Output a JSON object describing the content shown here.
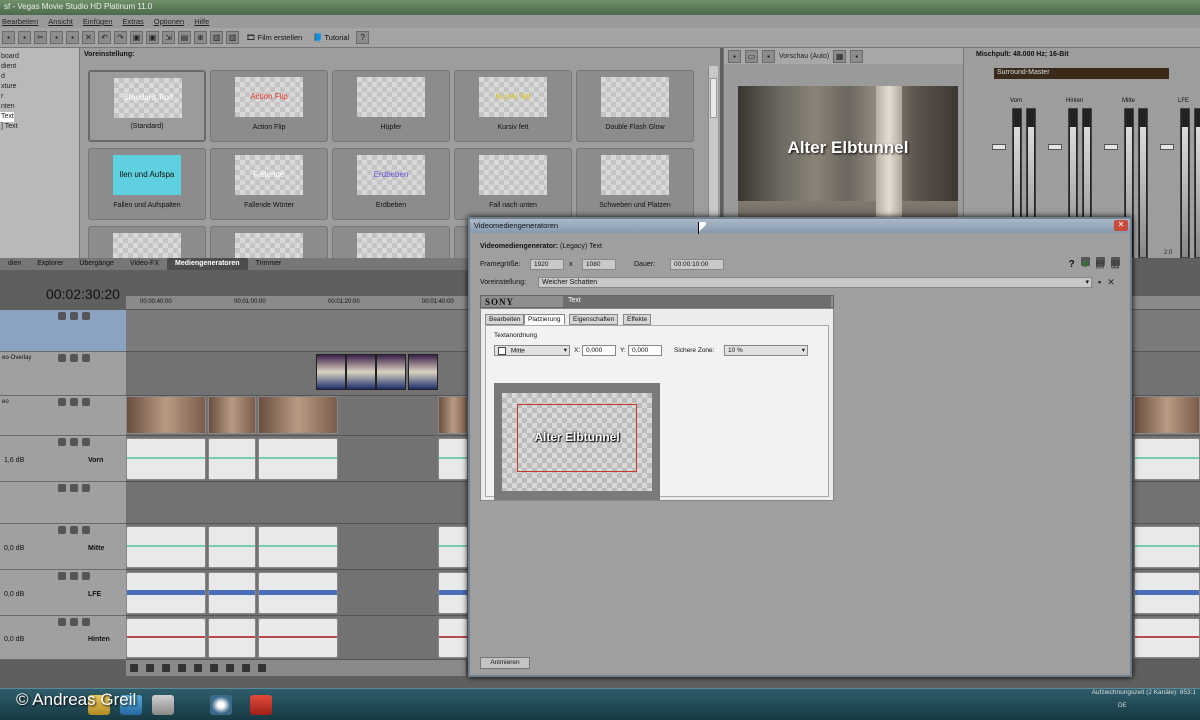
{
  "window": {
    "title": "sf - Vegas Movie Studio HD Platinum 11.0"
  },
  "menu": [
    "Bearbeiten",
    "Ansicht",
    "Einfügen",
    "Extras",
    "Optionen",
    "Hilfe"
  ],
  "toolbar": {
    "film_label": "Film erstellen",
    "tutorial_label": "Tutorial"
  },
  "explorer": {
    "items": [
      "board",
      "dient",
      "d",
      "xture",
      "r",
      "nten",
      "Text",
      "] Text"
    ]
  },
  "presets": {
    "header": "Voreinstellung:",
    "cards": [
      {
        "thumb": "Standard Text",
        "label": "(Standard)",
        "color": "#ffffff"
      },
      {
        "thumb": "Action Flip",
        "label": "Action Flip",
        "color": "#e33a2a"
      },
      {
        "thumb": "",
        "label": "Hüpfer",
        "color": "#4ca24c"
      },
      {
        "thumb": "Kursiv fett",
        "label": "Kursiv fett",
        "color": "#d8c21e"
      },
      {
        "thumb": "",
        "label": "Double Flash Glow",
        "color": "#e07ac0"
      },
      {
        "thumb": "llen und Aufspa",
        "label": "Fallen und Aufspalten",
        "color": "#111111"
      },
      {
        "thumb": "Fallende",
        "label": "Fallende Wörter",
        "color": "#ffffff"
      },
      {
        "thumb": "Erdbeben",
        "label": "Erdbeben",
        "color": "#6a4bd2"
      },
      {
        "thumb": "",
        "label": "Fall nach unten",
        "color": "#2aa4c0"
      },
      {
        "thumb": "",
        "label": "Schweben und Platzen",
        "color": "#d04a7a"
      },
      {
        "thumb": "",
        "label": "",
        "color": "#d05ab0"
      },
      {
        "thumb": "",
        "label": "",
        "color": "#888888"
      },
      {
        "thumb": "",
        "label": "",
        "color": "#c05aa0"
      },
      {
        "thumb": "",
        "label": "",
        "color": "#888888"
      },
      {
        "thumb": "",
        "label": "",
        "color": "#888888"
      }
    ]
  },
  "preview": {
    "quality": "Vorschau (Auto)",
    "overlay_text": "Alter Elbtunnel"
  },
  "mixer": {
    "header": "Mischpult: 48.000 Hz; 16-Bit",
    "master": "Surround-Master",
    "channels": [
      "Vorn",
      "Hinten",
      "Mitte",
      "LFE"
    ],
    "bottom_value": "2.0"
  },
  "tabs": [
    {
      "label": "dien",
      "active": false
    },
    {
      "label": "Explorer",
      "active": false
    },
    {
      "label": "Übergänge",
      "active": false
    },
    {
      "label": "Video-FX",
      "active": false
    },
    {
      "label": "Mediengeneratoren",
      "active": true
    },
    {
      "label": "Trimmer",
      "active": false
    }
  ],
  "timeline": {
    "timecode": "00:02:30:20",
    "ruler": [
      "00:00:40:00",
      "00:01:00:00",
      "00:01:20:00",
      "00:01:40:00"
    ],
    "tracks": [
      {
        "name": "",
        "vol": "",
        "label": "",
        "blue": true
      },
      {
        "name": "eo-Overlay",
        "vol": "",
        "label": "",
        "blue": false
      },
      {
        "name": "eo",
        "vol": "",
        "label": "",
        "blue": false
      },
      {
        "name": "",
        "vol": "1,6 dB",
        "label": "Vorn",
        "blue": false
      },
      {
        "name": "",
        "vol": "",
        "label": "",
        "blue": false
      },
      {
        "name": "",
        "vol": "0,0 dB",
        "label": "Mitte",
        "blue": false
      },
      {
        "name": "",
        "vol": "0,0 dB",
        "label": "LFE",
        "blue": false
      },
      {
        "name": "",
        "vol": "0,0 dB",
        "label": "Hinten",
        "blue": false
      }
    ]
  },
  "dialog": {
    "title": "Videomediengeneratoren",
    "generator_label": "Videomediengenerator:",
    "generator_value": "(Legacy) Text",
    "framesize_label": "Framegröße:",
    "width": "1920",
    "x": "x",
    "height": "1080",
    "duration_label": "Dauer:",
    "duration": "00:00:10:00",
    "preset_label": "Voreinstellung:",
    "preset_value": "Weicher Schatten",
    "sony": "SONY",
    "plugin_title": "Text",
    "tabs": [
      "Bearbeiten",
      "Platzierung",
      "Eigenschaften",
      "Effekte"
    ],
    "active_tab": "Platzierung",
    "arrangement_label": "Textanordnung",
    "arrangement_value": "Mitte",
    "x_label": "X:",
    "x_value": "0,000",
    "y_label": "Y:",
    "y_value": "0,000",
    "safe_zone_label": "Sichere Zone:",
    "safe_zone_value": "10 %",
    "preview_text": "Alter Elbtunnel",
    "animate_label": "Animieren"
  },
  "taskbar": {
    "status": "Aufzeichnungszeit (2 Kanäle): 653:1",
    "lang": "DE"
  },
  "watermark": "© Andreas Greil"
}
